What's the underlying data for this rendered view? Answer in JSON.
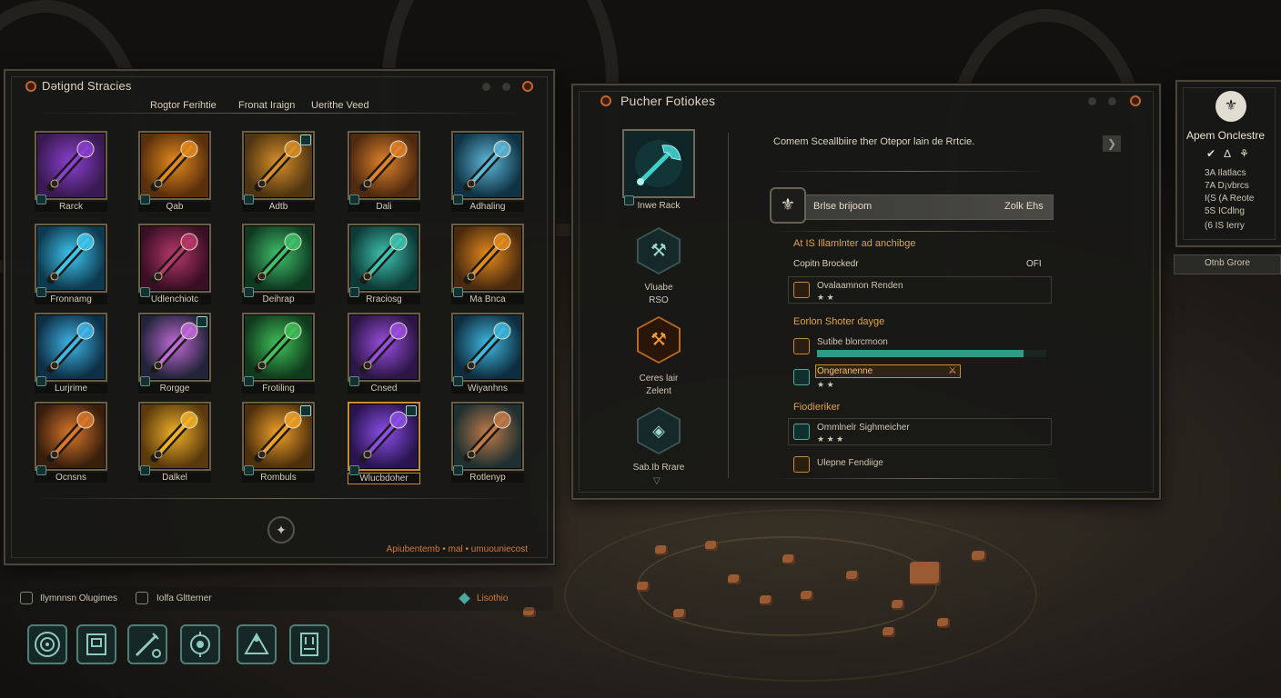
{
  "left_panel": {
    "title": "Dətignd Stracies",
    "tabs": [
      "Rogtor Ferihtie",
      "Fronat Iraign",
      "Uerithe Veed"
    ],
    "items": [
      {
        "label": "Rarck",
        "icon": "dagger-icon",
        "accent": "#8a3fd0",
        "bg": "#3a1a52"
      },
      {
        "label": "Qab",
        "icon": "mace-icon",
        "accent": "#e38a1e",
        "bg": "#5a2f0c"
      },
      {
        "label": "Adtb",
        "icon": "gauntlet-icon",
        "accent": "#d88f2a",
        "bg": "#4e3410"
      },
      {
        "label": "Dali",
        "icon": "hammer-icon",
        "accent": "#e0822a",
        "bg": "#4e2a10"
      },
      {
        "label": "Adhaling",
        "icon": "spear-icon",
        "accent": "#5fb7d8",
        "bg": "#0f3344"
      },
      {
        "label": "Fronnamg",
        "icon": "sword-icon",
        "accent": "#3fc6f0",
        "bg": "#0d3a4e"
      },
      {
        "label": "Udlenchiotc",
        "icon": "crossed-blades-icon",
        "accent": "#b8386a",
        "bg": "#3a0f24"
      },
      {
        "label": "Deihrap",
        "icon": "staff-icon",
        "accent": "#3fc06a",
        "bg": "#0f3a22"
      },
      {
        "label": "Rraciosg",
        "icon": "star-mace-icon",
        "accent": "#3fc3b0",
        "bg": "#0d3a36"
      },
      {
        "label": "Ma Bnca",
        "icon": "armor-icon",
        "accent": "#e38a1e",
        "bg": "#4a2a0e"
      },
      {
        "label": "Lurjrime",
        "icon": "gem-staff-icon",
        "accent": "#3fb5e8",
        "bg": "#0d3046"
      },
      {
        "label": "Rorgge",
        "icon": "cannon-icon",
        "accent": "#c06ad8",
        "bg": "#23243a"
      },
      {
        "label": "Frotiling",
        "icon": "glaive-icon",
        "accent": "#41c05a",
        "bg": "#0f3a1c"
      },
      {
        "label": "Cnsed",
        "icon": "rod-icon",
        "accent": "#9a4ee0",
        "bg": "#2c1646"
      },
      {
        "label": "Wiyanhns",
        "icon": "ice-spear-icon",
        "accent": "#3fb8e0",
        "bg": "#0e2e40"
      },
      {
        "label": "Ocnsns",
        "icon": "flail-icon",
        "accent": "#d8762a",
        "bg": "#3a1e0c"
      },
      {
        "label": "Dalkel",
        "icon": "fire-blade-icon",
        "accent": "#f0b02a",
        "bg": "#5a3a0c"
      },
      {
        "label": "Rombuls",
        "icon": "fire-mace-icon",
        "accent": "#f0a02a",
        "bg": "#4e300c"
      },
      {
        "label": "Wlucbdoher",
        "icon": "void-hammer-icon",
        "accent": "#8b4fe8",
        "bg": "#2a1450"
      },
      {
        "label": "Rotlenyp",
        "icon": "heavy-gauntlet-icon",
        "accent": "#c07a4a",
        "bg": "#1e3030"
      }
    ],
    "footer_text": "Apiubentemb • mal • umuouniecost"
  },
  "bottom_left": {
    "hint1": "Ilymnnsn Olugimes",
    "hint2": "Iolfa Gltterner",
    "hint3": "Lisothio"
  },
  "hotbar": [
    {
      "name": "target-icon"
    },
    {
      "name": "inventory-icon"
    },
    {
      "name": "weapon-craft-icon"
    },
    {
      "name": "skill-tree-icon"
    },
    {
      "name": "camp-icon"
    },
    {
      "name": "map-icon"
    }
  ],
  "right_panel": {
    "title": "Pucher Fotiokes",
    "description": "Comem Sceallbiire ther Otepor lain de Rrtcie.",
    "selected_item_label": "Inwe Rack",
    "side_options": [
      {
        "label": "Vluabe",
        "sub": "RSO"
      },
      {
        "label": "Ceres lair",
        "sub": "Zelent"
      },
      {
        "label": "Sab.Ib Rrare",
        "sub": ""
      }
    ],
    "header_bar": {
      "name": "Brlse brijoom",
      "value": "Zolk Ehs"
    },
    "section1": {
      "title": "At IS Illamlnter ad anchibge",
      "row_label": "Copitn Brockedr",
      "row_value": "OFI",
      "stat": {
        "name": "Ovalaamnon Renden",
        "stars": "★ ★"
      }
    },
    "section2": {
      "title": "Eorlon Shoter dayge",
      "bar_stat": "Sutibe blorcmoon",
      "bar_fill": 0.9,
      "highlight_stat": "Ongeranenne",
      "highlight_stars": "★ ★"
    },
    "section3": {
      "title": "Fiodieriker",
      "stat1": "Ommlnelr Sighmeicher",
      "stat1_stars": "★ ★ ★",
      "stat2": "Ulepne Fendiige"
    }
  },
  "far_right": {
    "title": "Apem Onclestre",
    "icons_row": "✔ ∆ ⚘",
    "lines": [
      "3A Ilatlacs",
      "7A D¡vbrcs",
      "I(S (A Reote",
      "5S ICdlng",
      "(6 IS Ierry"
    ],
    "button": "Otnb Grore"
  }
}
